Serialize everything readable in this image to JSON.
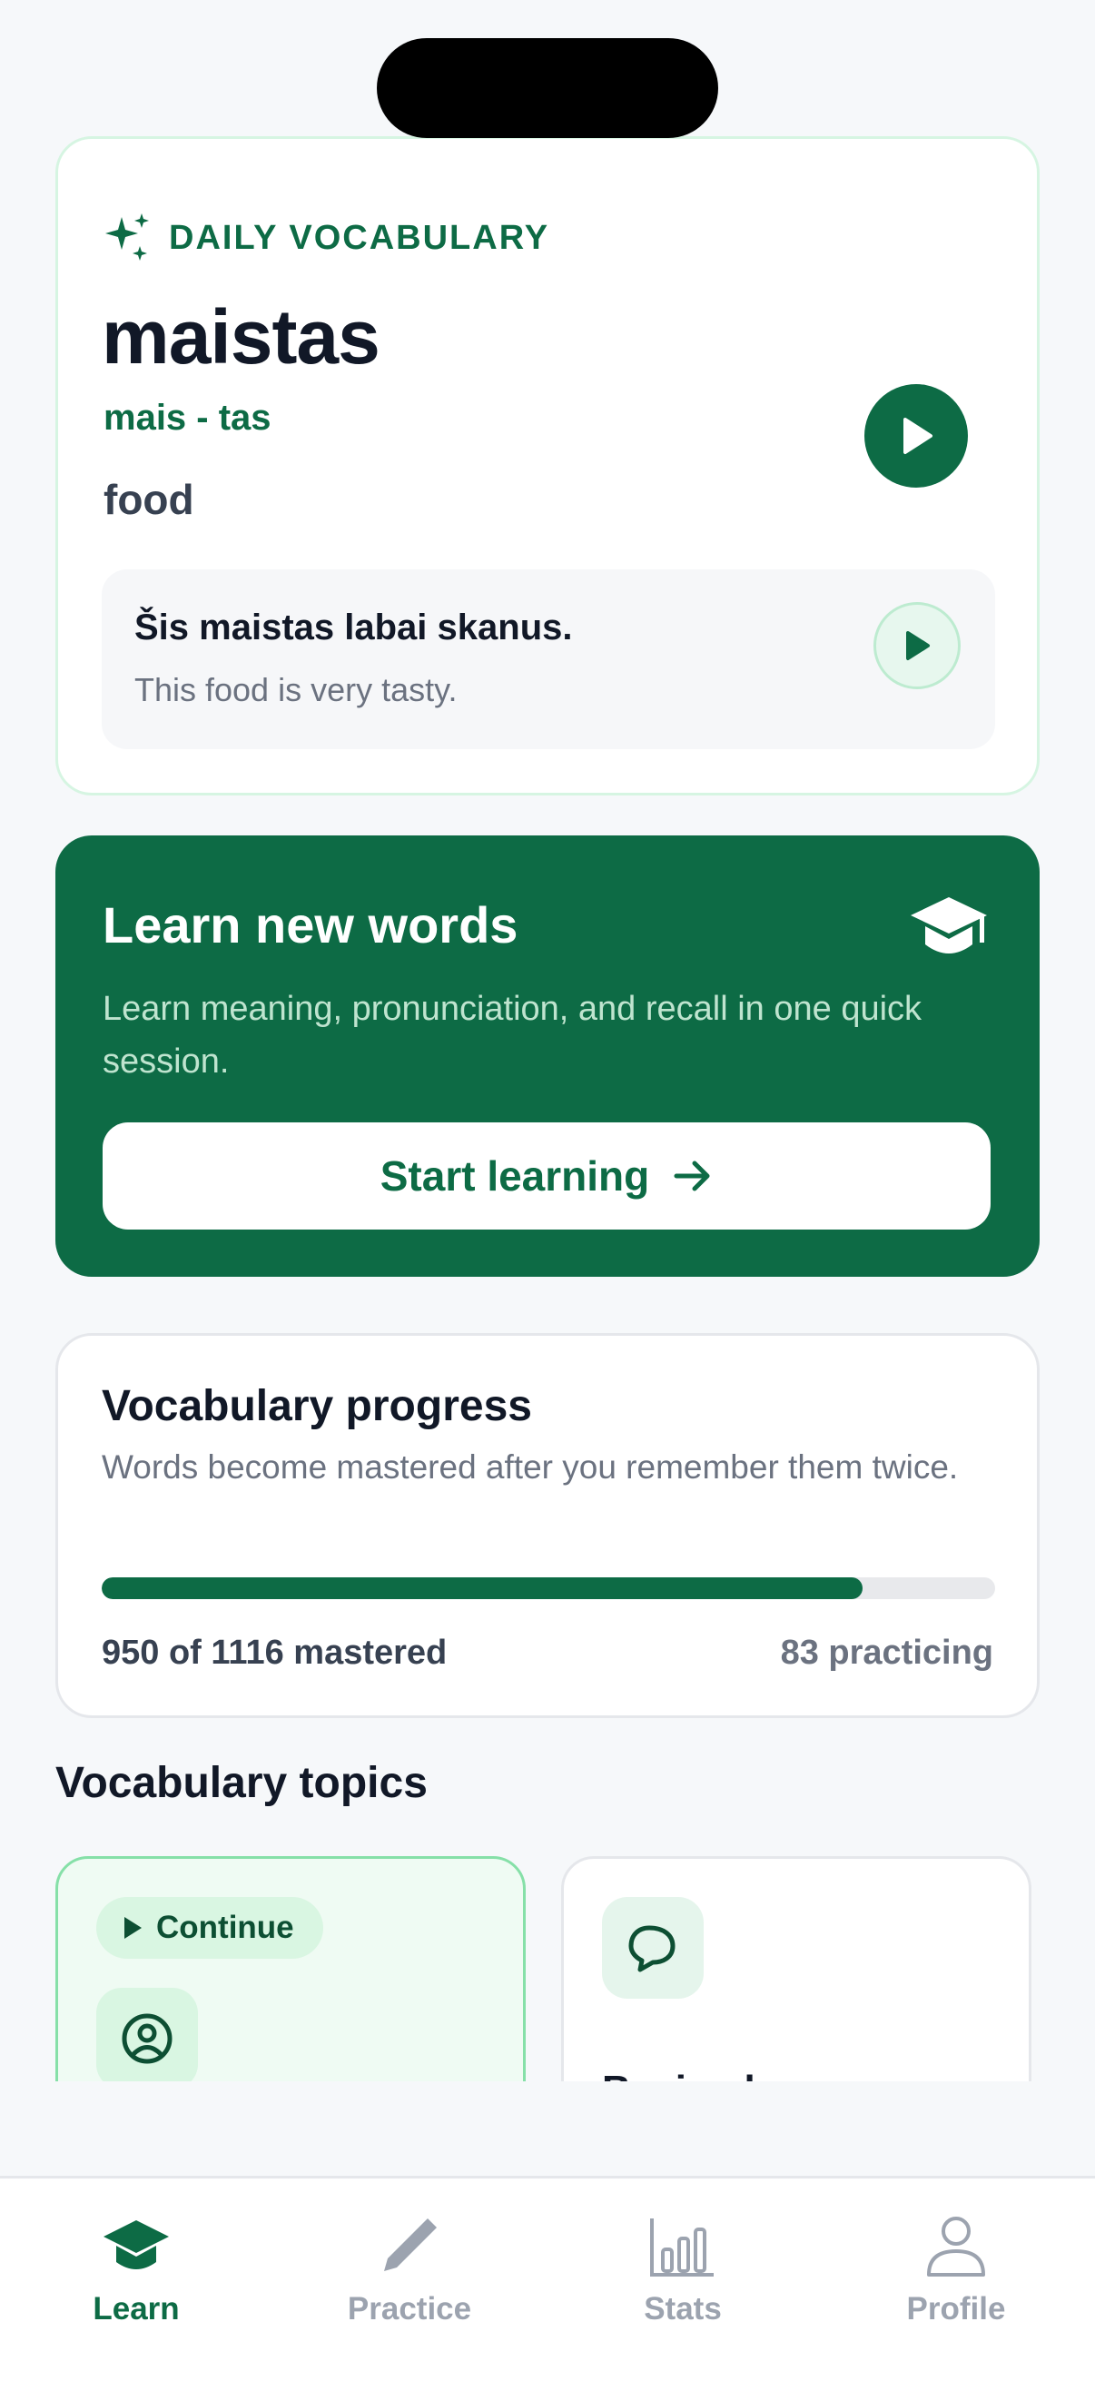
{
  "daily": {
    "label": "DAILY VOCABULARY",
    "word": "maistas",
    "phonetic": "mais - tas",
    "meaning": "food",
    "example": "Šis maistas labai skanus.",
    "example_translation": "This food is very tasty."
  },
  "learn": {
    "title": "Learn new words",
    "description": "Learn meaning, pronunciation, and recall in one quick session.",
    "button_label": "Start learning"
  },
  "progress": {
    "title": "Vocabulary progress",
    "description": "Words become mastered after you remember them twice.",
    "mastered_text": "950 of 1116 mastered",
    "practicing_text": "83 practicing",
    "mastered": 950,
    "total": 1116
  },
  "topics": {
    "title": "Vocabulary topics",
    "items": [
      {
        "pill": "Continue",
        "icon": "user-circle-icon"
      },
      {
        "name": "Basic phrases",
        "icon": "chat-bubbles-icon"
      }
    ]
  },
  "tabbar": {
    "items": [
      {
        "label": "Learn",
        "icon": "graduation-cap-icon",
        "active": true
      },
      {
        "label": "Practice",
        "icon": "pencil-icon",
        "active": false
      },
      {
        "label": "Stats",
        "icon": "bar-chart-icon",
        "active": false
      },
      {
        "label": "Profile",
        "icon": "person-icon",
        "active": false
      }
    ]
  },
  "colors": {
    "brand": "#0d6b45",
    "background": "#f6f8fa",
    "accent_light": "#effbf3"
  }
}
